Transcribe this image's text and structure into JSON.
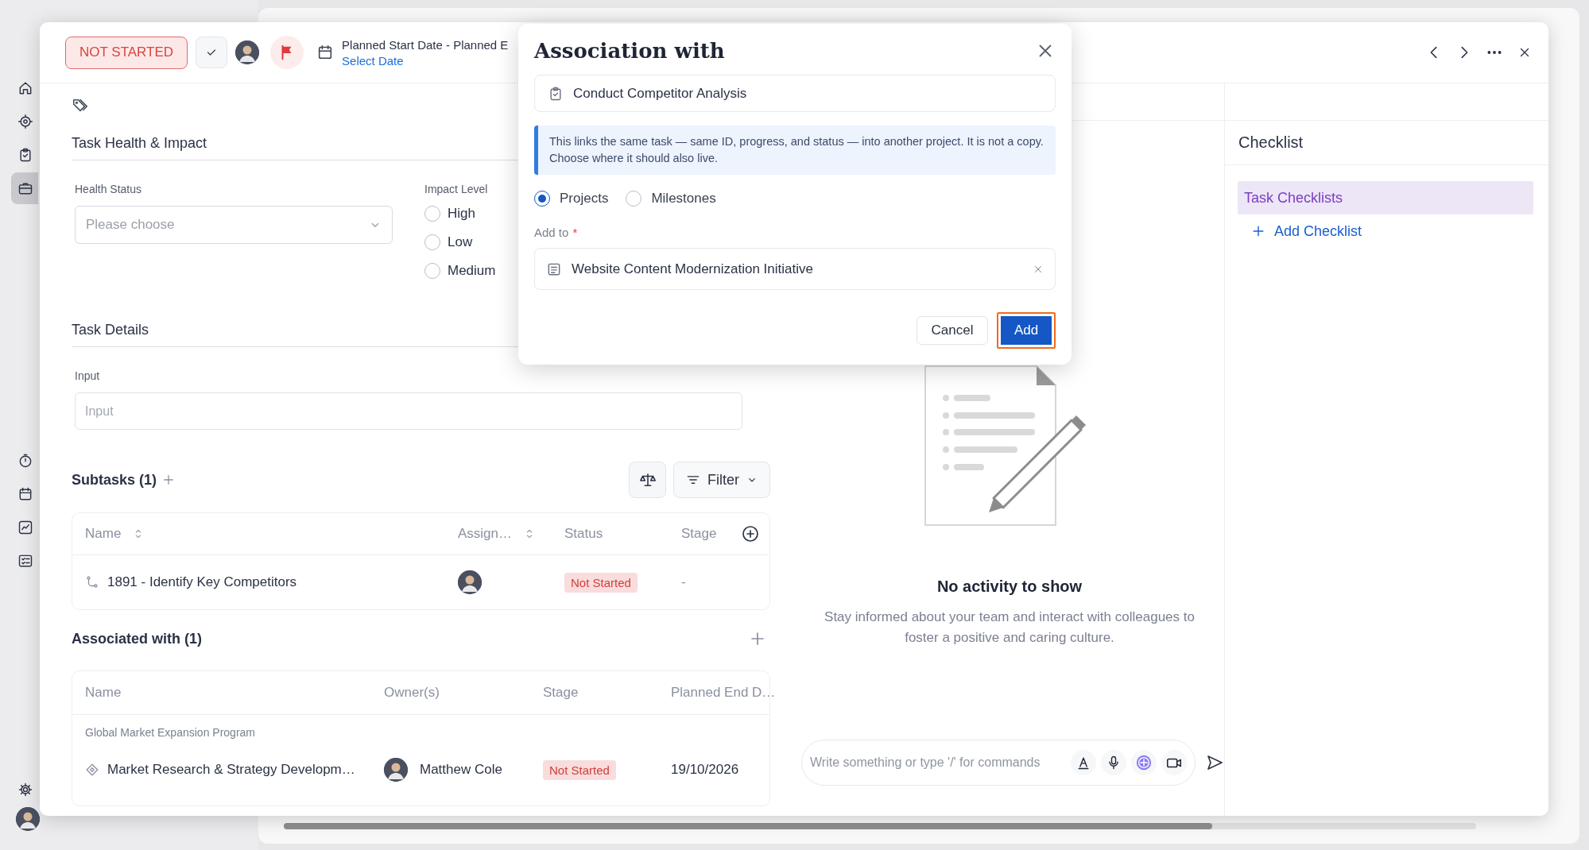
{
  "sidebar": {
    "items": [
      {
        "selected": false
      },
      {
        "selected": false
      },
      {
        "selected": false
      },
      {
        "selected": true
      },
      {
        "selected": false
      },
      {
        "selected": false
      },
      {
        "selected": false
      },
      {
        "selected": false
      }
    ]
  },
  "task_panel": {
    "header": {
      "status": "NOT STARTED",
      "date_label": "Planned Start Date - Planned E",
      "date_value": "Select Date"
    },
    "health_section": {
      "title": "Task Health & Impact",
      "health_status": {
        "label": "Health Status",
        "placeholder": "Please choose"
      },
      "impact_level": {
        "label": "Impact Level",
        "options": [
          {
            "label": "High",
            "selected": false
          },
          {
            "label": "Low",
            "selected": false
          },
          {
            "label": "Medium",
            "selected": false
          }
        ]
      }
    },
    "details_section": {
      "title": "Task Details",
      "input": {
        "label": "Input",
        "placeholder": "Input"
      }
    },
    "subtasks": {
      "title": "Subtasks (1)",
      "filter": "Filter",
      "columns": [
        "Name",
        "Assign…",
        "Status",
        "Stage"
      ],
      "rows": [
        {
          "name": "1891 - Identify Key Competitors",
          "status": "Not Started",
          "stage": "-"
        }
      ]
    },
    "associated": {
      "title": "Associated with (1)",
      "columns": [
        "Name",
        "Owner(s)",
        "Stage",
        "Planned End D…"
      ],
      "groups": [
        {
          "label": "Global Market Expansion Program",
          "rows": [
            {
              "name": "Market Research & Strategy Developm…",
              "owner": "Matthew Cole",
              "stage": "Not Started",
              "planned_end": "19/10/2026"
            }
          ]
        }
      ]
    },
    "activity": {
      "empty_title": "No activity to show",
      "empty_text": "Stay informed about your team and interact with colleagues to foster a positive and caring culture.",
      "composer": {
        "placeholder": "Write something or type '/' for commands"
      }
    },
    "checklist": {
      "title": "Checklist",
      "items": [
        {
          "label": "Task Checklists",
          "selected": true
        }
      ],
      "add": "Add Checklist"
    }
  },
  "dialog": {
    "title": "Association with",
    "task": "Conduct Competitor Analysis",
    "info": "This links the same task — same ID, progress, and status — into another project. It is not a copy. Choose where it should also live.",
    "target_types": [
      {
        "label": "Projects",
        "selected": true
      },
      {
        "label": "Milestones",
        "selected": false
      }
    ],
    "add_to": {
      "label": "Add to",
      "required_mark": "*",
      "value": "Website Content Modernization Initiative"
    },
    "buttons": [
      {
        "label": "Cancel",
        "kind": "secondary",
        "focused": false
      },
      {
        "label": "Add",
        "kind": "primary",
        "focused": true
      }
    ]
  }
}
